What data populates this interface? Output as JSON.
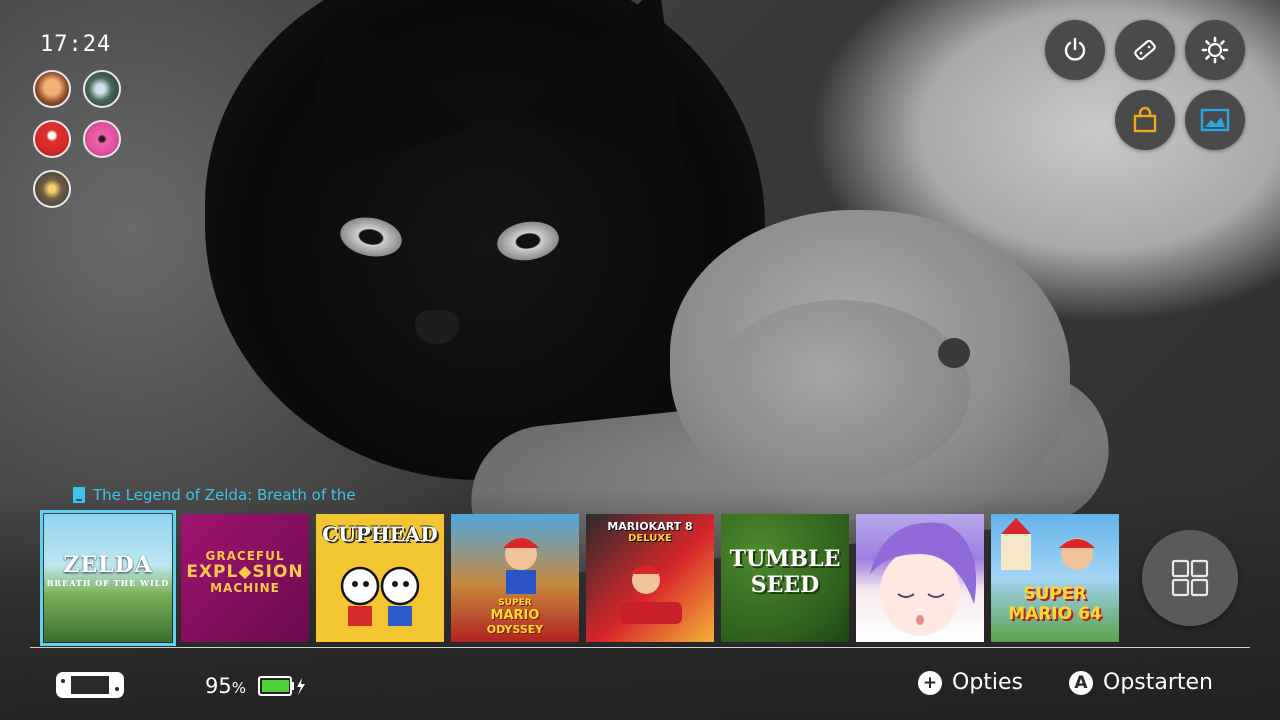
{
  "status": {
    "time": "17:24",
    "battery_percent": "95",
    "battery_unit": "%"
  },
  "users": [
    {
      "name": "user-1"
    },
    {
      "name": "user-2"
    },
    {
      "name": "user-3"
    },
    {
      "name": "user-4"
    },
    {
      "name": "user-5"
    }
  ],
  "top_buttons": [
    "power-icon",
    "controller-icon",
    "settings-icon",
    "eshop-icon",
    "album-icon"
  ],
  "selected_game": {
    "title": "The Legend of Zelda: Breath of the"
  },
  "games": [
    {
      "id": "zelda",
      "title_line1": "ZELDA",
      "title_line2": "BREATH OF THE WILD"
    },
    {
      "id": "graceful",
      "title_line1": "GRACEFUL",
      "title_line2": "EXPL◆SION",
      "title_line3": "MACHINE"
    },
    {
      "id": "cuphead",
      "title_line1": "CUPHEAD"
    },
    {
      "id": "odyssey",
      "title_line1": "SUPER",
      "title_line2": "MARIO",
      "title_line3": "ODYSSEY"
    },
    {
      "id": "mk8",
      "title_line1": "MARIOKART 8",
      "title_line2": "DELUXE"
    },
    {
      "id": "tumbleseed",
      "title_line1": "TUMBLE",
      "title_line2": "SEED"
    },
    {
      "id": "anime",
      "title_line1": ""
    },
    {
      "id": "sm64",
      "title_line1": "SUPER",
      "title_line2": "MARIO 64"
    }
  ],
  "footer": {
    "options_label": "Opties",
    "options_glyph": "+",
    "launch_label": "Opstarten",
    "launch_glyph": "A"
  },
  "colors": {
    "accent": "#3ec3ea",
    "battery": "#4cd137"
  }
}
